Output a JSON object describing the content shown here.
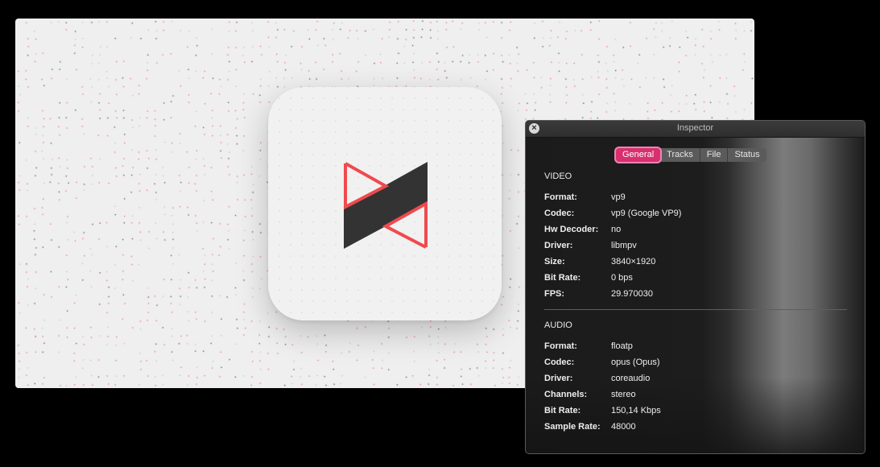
{
  "colors": {
    "accent": "#d8306f",
    "logo_red": "#ef4a4e",
    "logo_dark": "#333333"
  },
  "player": {
    "app_icon": "mpv-logo-icon"
  },
  "inspector": {
    "title": "Inspector",
    "close_icon": "close-icon",
    "tabs": [
      {
        "label": "General",
        "active": true
      },
      {
        "label": "Tracks",
        "active": false
      },
      {
        "label": "File",
        "active": false
      },
      {
        "label": "Status",
        "active": false
      }
    ],
    "video": {
      "heading": "VIDEO",
      "rows": [
        {
          "label": "Format:",
          "value": "vp9"
        },
        {
          "label": "Codec:",
          "value": "vp9 (Google VP9)"
        },
        {
          "label": "Hw Decoder:",
          "value": "no"
        },
        {
          "label": "Driver:",
          "value": "libmpv"
        },
        {
          "label": "Size:",
          "value": "3840×1920"
        },
        {
          "label": "Bit Rate:",
          "value": "0 bps"
        },
        {
          "label": "FPS:",
          "value": "29.970030"
        }
      ]
    },
    "audio": {
      "heading": "AUDIO",
      "rows": [
        {
          "label": "Format:",
          "value": "floatp"
        },
        {
          "label": "Codec:",
          "value": "opus (Opus)"
        },
        {
          "label": "Driver:",
          "value": "coreaudio"
        },
        {
          "label": "Channels:",
          "value": "stereo"
        },
        {
          "label": "Bit Rate:",
          "value": "150,14 Kbps"
        },
        {
          "label": "Sample Rate:",
          "value": "48000"
        }
      ]
    }
  }
}
